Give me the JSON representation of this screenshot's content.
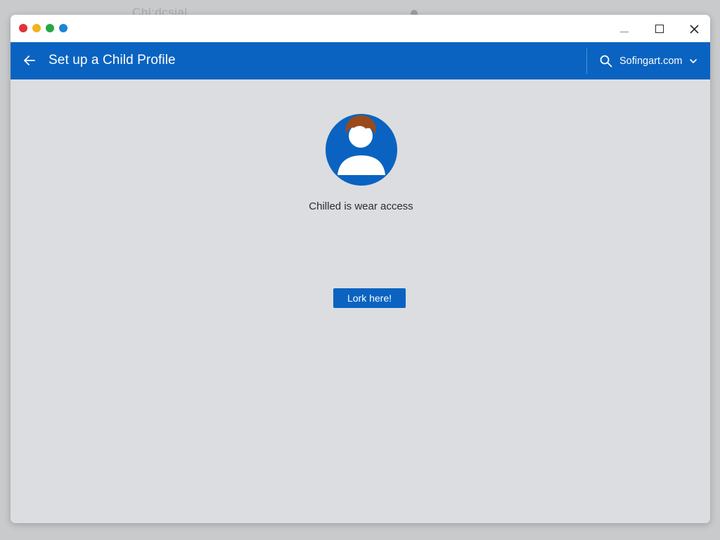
{
  "background": {
    "ghost_title": "Chl:dcsial"
  },
  "window": {
    "traffic_lights": [
      {
        "name": "red-dot-icon",
        "color": "#e3323a"
      },
      {
        "name": "yellow-dot-icon",
        "color": "#f2b41d"
      },
      {
        "name": "green-dot-icon",
        "color": "#27a844"
      },
      {
        "name": "blue-dot-icon",
        "color": "#1a86d6"
      }
    ],
    "controls": {
      "minimize_icon": "minimize-icon",
      "maximize_icon": "maximize-icon",
      "close_icon": "close-icon"
    }
  },
  "header": {
    "back_icon": "arrow-left-icon",
    "title": "Set up a Child Profile",
    "account": {
      "search_icon": "search-icon",
      "label": "Sofingart.com",
      "chevron_icon": "chevron-down-icon"
    },
    "color": "#0a63c1"
  },
  "main": {
    "avatar_icon": "child-avatar-icon",
    "status": "Chilled is wear access",
    "primary_button_label": "Lork here!"
  },
  "colors": {
    "accent": "#0a63c1",
    "hair": "#9a4a1c",
    "content_bg": "#dcdde0"
  }
}
